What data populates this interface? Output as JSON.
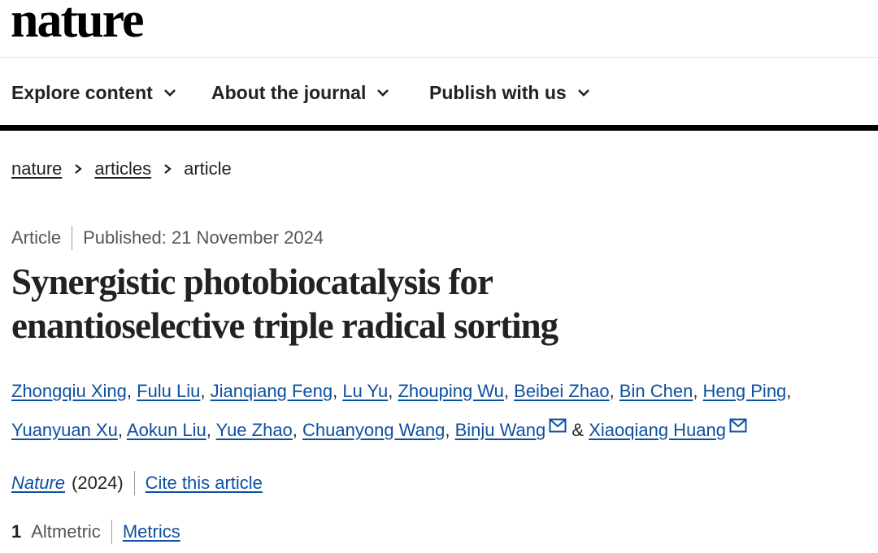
{
  "header": {
    "logo": "nature"
  },
  "nav": {
    "items": [
      {
        "label": "Explore content"
      },
      {
        "label": "About the journal"
      },
      {
        "label": "Publish with us"
      }
    ]
  },
  "breadcrumb": {
    "items": [
      {
        "label": "nature",
        "link": true
      },
      {
        "label": "articles",
        "link": true
      },
      {
        "label": "article",
        "link": false
      }
    ]
  },
  "article": {
    "type": "Article",
    "published": "Published: 21 November 2024",
    "title_line1": "Synergistic photobiocatalysis for",
    "title_line2": "enantioselective triple radical sorting",
    "authors_line1": [
      "Zhongqiu Xing",
      "Fulu Liu",
      "Jianqiang Feng",
      "Lu Yu",
      "Zhouping Wu",
      "Beibei Zhao",
      "Bin Chen",
      "Heng Ping"
    ],
    "authors_line2": [
      "Yuanyuan Xu",
      "Aokun Liu",
      "Yue Zhao",
      "Chuanyong Wang",
      "Binju Wang",
      "Xiaoqiang Huang"
    ],
    "corresponding_conjunction": "&",
    "journal": "Nature",
    "year": "(2024)",
    "cite_label": "Cite this article",
    "altmetric_count": "1",
    "altmetric_label": "Altmetric",
    "metrics_label": "Metrics"
  },
  "colors": {
    "link": "#0e50a0",
    "text": "#222222",
    "muted": "#555555",
    "rule": "#000000"
  },
  "icons": {
    "nav_dropdown": "chevron-down-icon",
    "breadcrumb_sep": "chevron-right-icon",
    "contact": "mail-icon"
  }
}
